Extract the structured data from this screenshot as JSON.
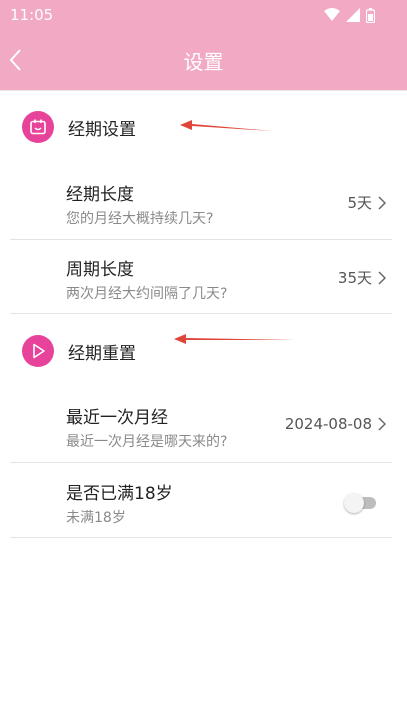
{
  "status_bar": {
    "time": "11:05",
    "icons": [
      "wifi-icon",
      "signal-icon",
      "battery-icon"
    ]
  },
  "app_bar": {
    "title": "设置",
    "back_icon": "chevron-left-icon"
  },
  "colors": {
    "header_pink": "#f2a9c3",
    "accent_magenta": "#e8439b",
    "annotation_red": "#e0453a"
  },
  "sections": [
    {
      "label": "经期设置",
      "icon": "calendar-icon",
      "rows": [
        {
          "title": "经期长度",
          "subtitle": "您的月经大概持续几天?",
          "value": "5天"
        },
        {
          "title": "周期长度",
          "subtitle": "两次月经大约间隔了几天?",
          "value": "35天"
        }
      ]
    },
    {
      "label": "经期重置",
      "icon": "play-icon",
      "rows": [
        {
          "title": "最近一次月经",
          "subtitle": "最近一次月经是哪天来的?",
          "value": "2024-08-08"
        },
        {
          "title": "是否已满18岁",
          "subtitle": "未满18岁",
          "toggle_on": false
        }
      ]
    }
  ]
}
